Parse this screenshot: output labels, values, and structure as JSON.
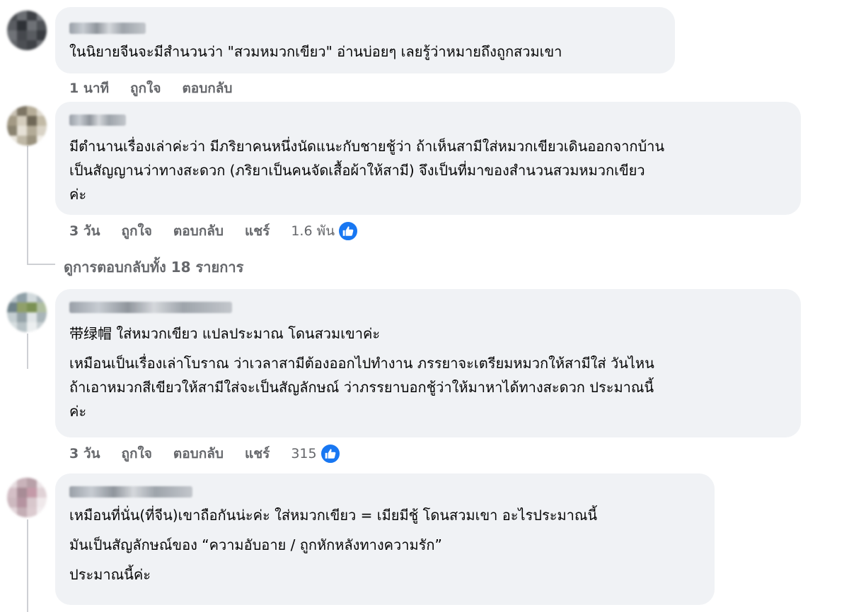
{
  "comments": [
    {
      "lines": [
        "ในนิยายจีนจะมีสำนวนว่า \"สวมหมวกเขียว\" อ่านบ่อยๆ เลยรู้ว่าหมายถึงถูกสวมเขา"
      ],
      "time": "1 นาที",
      "like_label": "ถูกใจ",
      "reply_label": "ตอบกลับ"
    },
    {
      "lines": [
        "มีตำนานเรื่องเล่าค่ะว่า มีภริยาคนหนึ่งนัดแนะกับชายชู้ว่า ถ้าเห็นสามีใส่หมวกเขียวเดินออกจากบ้าน",
        "เป็นสัญญานว่าทางสะดวก (ภริยาเป็นคนจัดเสื้อผ้าให้สามี) จึงเป็นที่มาของสำนวนสวมหมวกเขียว",
        "ค่ะ"
      ],
      "time": "3 วัน",
      "like_label": "ถูกใจ",
      "reply_label": "ตอบกลับ",
      "share_label": "แชร์",
      "reactions": "1.6 พัน"
    },
    {
      "lines": [
        "带绿帽 ใส่หมวกเขียว แปลประมาณ โดนสวมเขาค่ะ"
      ],
      "lines2": [
        "เหมือนเป็นเรื่องเล่าโบราณ ว่าเวลาสามีต้องออกไปทำงาน ภรรยาจะเตรียมหมวกให้สามีใส่ วันไหน",
        "ถ้าเอาหมวกสีเขียวให้สามีใส่จะเป็นสัญลักษณ์ ว่าภรรยาบอกชู้ว่าให้มาหาได้ทางสะดวก ประมาณนี้",
        "ค่ะ"
      ],
      "time": "3 วัน",
      "like_label": "ถูกใจ",
      "reply_label": "ตอบกลับ",
      "share_label": "แชร์",
      "reactions": "315"
    },
    {
      "lines": [
        "เหมือนที่นั่น(ที่จีน)เขาถือกันน่ะค่ะ ใส่หมวกเขียว = เมียมีชู้ โดนสวมเขา อะไรประมาณนี้"
      ],
      "lines2": [
        "มันเป็นสัญลักษณ์ของ “ความอับอาย / ถูกหักหลังทางความรัก”"
      ],
      "lines3": [
        "ประมาณนี้ค่ะ"
      ]
    }
  ],
  "view_replies": "ดูการตอบกลับทั้ง 18 รายการ",
  "icons": {
    "reaction": "like-thumbs-up-icon"
  },
  "colors": {
    "bubble": "#f0f2f5",
    "meta_text": "#65676b",
    "like_blue": "#1877f2"
  }
}
